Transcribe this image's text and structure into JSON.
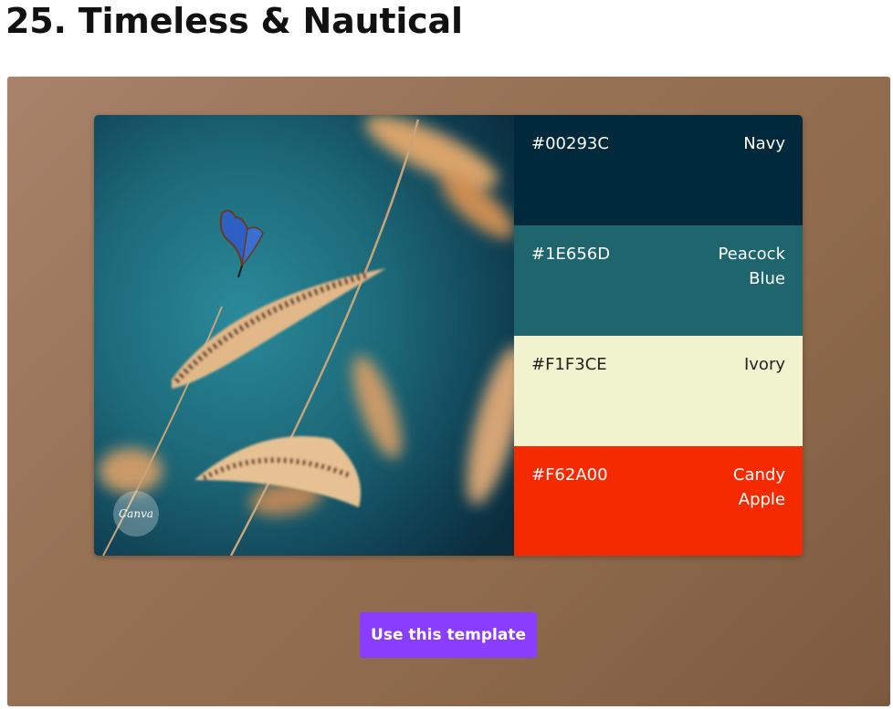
{
  "heading": "25. Timeless & Nautical",
  "palette": [
    {
      "hex": "#00293C",
      "name": "Navy",
      "bg": "#00293C",
      "fg": "#ffffff"
    },
    {
      "hex": "#1E656D",
      "name": "Peacock Blue",
      "bg": "#1E656D",
      "fg": "#ffffff"
    },
    {
      "hex": "#F1F3CE",
      "name": "Ivory",
      "bg": "#F1F3CE",
      "fg": "#222222"
    },
    {
      "hex": "#F62A00",
      "name": "Candy Apple",
      "bg": "#F62A00",
      "fg": "#ffffff"
    }
  ],
  "photo": {
    "badge_text": "Canva"
  },
  "cta": {
    "label": "Use this template",
    "color": "#8B3DFF"
  }
}
